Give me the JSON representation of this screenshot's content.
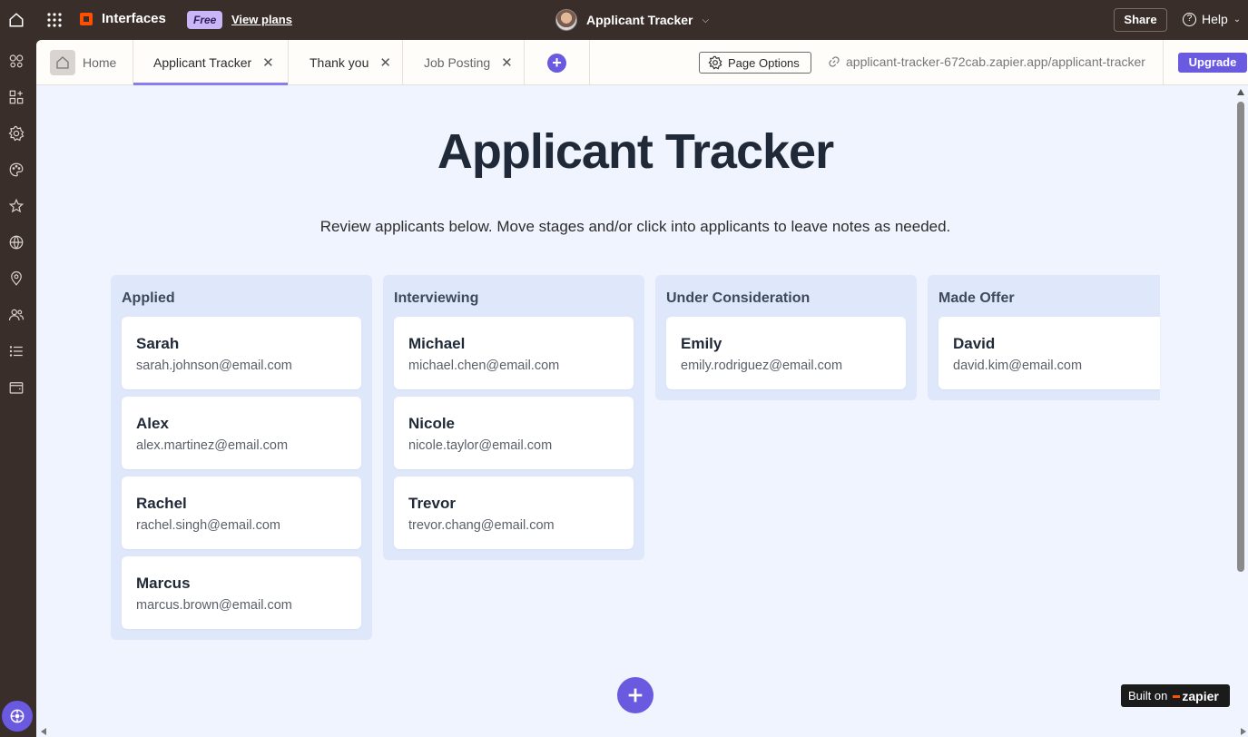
{
  "topbar": {
    "brand": "Interfaces",
    "plan_badge": "Free",
    "view_plans": "View plans",
    "app_name": "Applicant Tracker",
    "share": "Share",
    "help": "Help"
  },
  "tabs": {
    "home": "Home",
    "applicant_tracker": "Applicant Tracker",
    "thank_you": "Thank you",
    "job_posting": "Job Posting",
    "page_options": "Page Options",
    "url": "applicant-tracker-672cab.zapier.app/applicant-tracker",
    "upgrade": "Upgrade"
  },
  "page": {
    "title": "Applicant Tracker",
    "subtitle": "Review applicants below. Move stages and/or click into applicants to leave notes as needed."
  },
  "columns": [
    {
      "title": "Applied",
      "cards": [
        {
          "name": "Sarah",
          "email": "sarah.johnson@email.com"
        },
        {
          "name": "Alex",
          "email": "alex.martinez@email.com"
        },
        {
          "name": "Rachel",
          "email": "rachel.singh@email.com"
        },
        {
          "name": "Marcus",
          "email": "marcus.brown@email.com"
        }
      ]
    },
    {
      "title": "Interviewing",
      "cards": [
        {
          "name": "Michael",
          "email": "michael.chen@email.com"
        },
        {
          "name": "Nicole",
          "email": "nicole.taylor@email.com"
        },
        {
          "name": "Trevor",
          "email": "trevor.chang@email.com"
        }
      ]
    },
    {
      "title": "Under Consideration",
      "cards": [
        {
          "name": "Emily",
          "email": "emily.rodriguez@email.com"
        }
      ]
    },
    {
      "title": "Made Offer",
      "cards": [
        {
          "name": "David",
          "email": "david.kim@email.com"
        }
      ]
    }
  ],
  "footer": {
    "built_on": "Built on",
    "zapier": "zapier"
  },
  "colors": {
    "accent": "#6a5ae0",
    "topbar": "#3a2e2b",
    "page_bg": "#eff4ff",
    "column_bg": "#dfe7fb",
    "zapier_orange": "#ff4f00"
  }
}
